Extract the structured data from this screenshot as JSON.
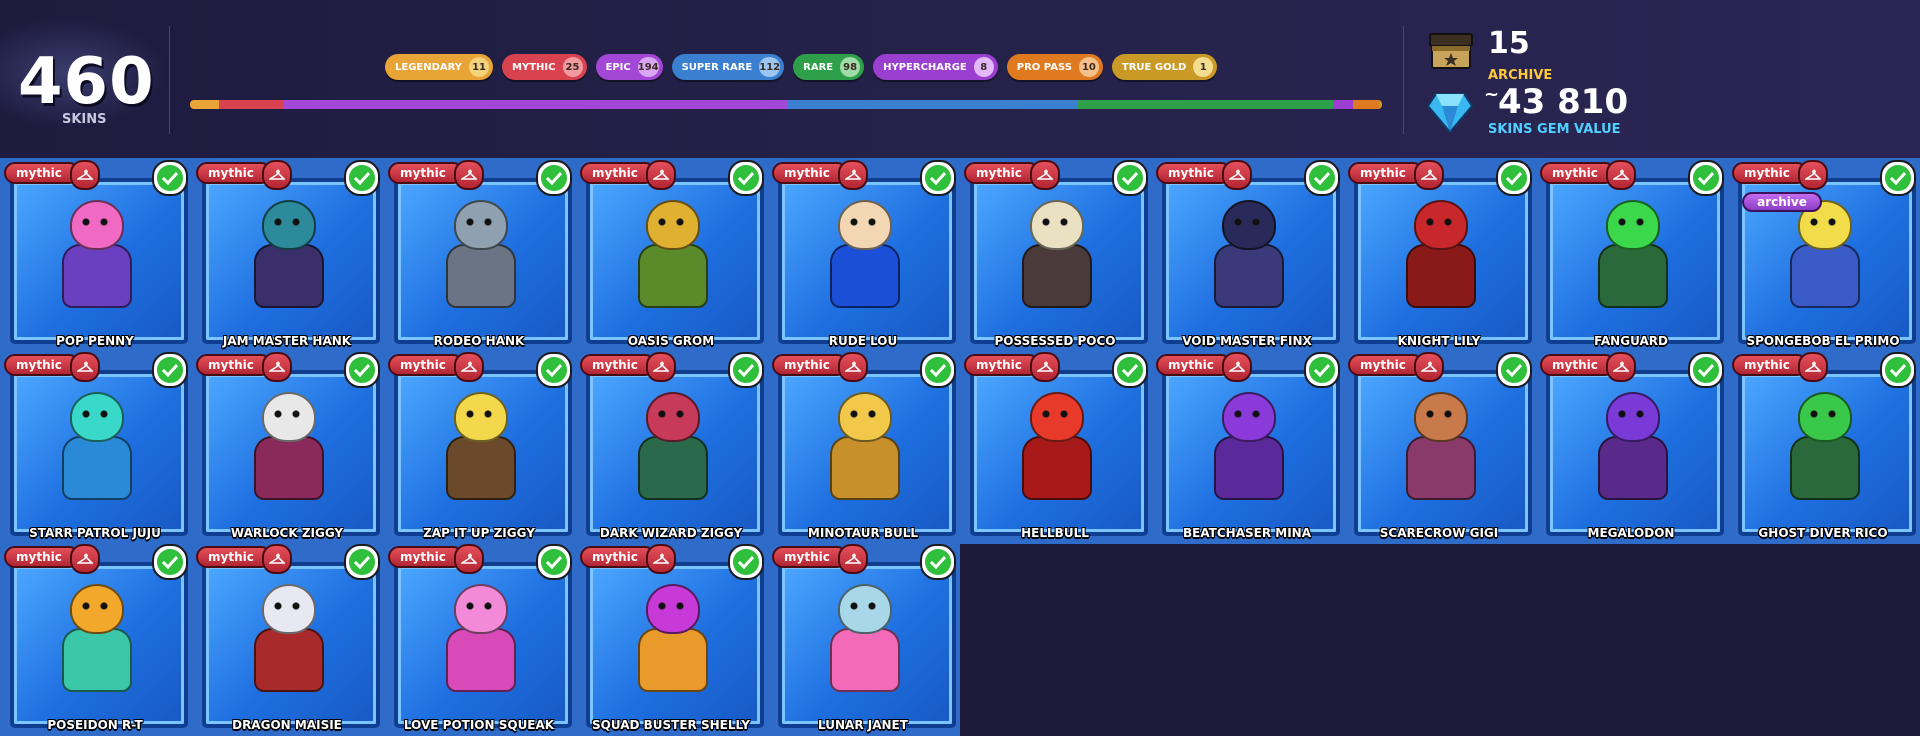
{
  "header": {
    "total_count": "460",
    "total_label": "SKINS",
    "rarities": [
      {
        "label": "LEGENDARY",
        "count": "11",
        "color": "#e8a436",
        "count_bg": "#f3d27a"
      },
      {
        "label": "MYTHIC",
        "count": "25",
        "color": "#d8434f",
        "count_bg": "#f29aa2"
      },
      {
        "label": "EPIC",
        "count": "194",
        "color": "#a347d6",
        "count_bg": "#d9a7f2"
      },
      {
        "label": "SUPER RARE",
        "count": "112",
        "color": "#3a7fd0",
        "count_bg": "#9cc6f2"
      },
      {
        "label": "RARE",
        "count": "98",
        "color": "#2fa04a",
        "count_bg": "#9fdca9"
      },
      {
        "label": "HYPERCHARGE",
        "count": "8",
        "color": "#9b3fd0",
        "count_bg": "#e2b8f7"
      },
      {
        "label": "PRO PASS",
        "count": "10",
        "color": "#e07a20",
        "count_bg": "#f6c08b"
      },
      {
        "label": "TRUE GOLD",
        "count": "1",
        "color": "#c99a26",
        "count_bg": "#f4dc91"
      }
    ],
    "archive_count": "15",
    "archive_label": "ARCHIVE",
    "gem_prefix": "~",
    "gem_value": "43 810",
    "gem_label": "SKINS GEM VALUE"
  },
  "badges": {
    "rarity": "mythic",
    "archive": "archive"
  },
  "colors": {
    "card_blue": "#2f6bc8",
    "badge_red": "#d8434f",
    "check_green": "#2fbf3a"
  },
  "skins": [
    {
      "name": "POP PENNY",
      "archive": false,
      "head": "#f06ac4",
      "body": "#6a3fc0"
    },
    {
      "name": "JAM MASTER HANK",
      "archive": false,
      "head": "#2c8a9a",
      "body": "#3a2f6a"
    },
    {
      "name": "RODEO HANK",
      "archive": false,
      "head": "#8fa0b0",
      "body": "#6a7484"
    },
    {
      "name": "OASIS GROM",
      "archive": false,
      "head": "#e0b030",
      "body": "#5a8a2a"
    },
    {
      "name": "RUDE LOU",
      "archive": false,
      "head": "#f3d7b5",
      "body": "#1c4fd8"
    },
    {
      "name": "POSSESSED POCO",
      "archive": false,
      "head": "#e9e1c2",
      "body": "#4a3a3a"
    },
    {
      "name": "VOID MASTER FINX",
      "archive": false,
      "head": "#2a2a5a",
      "body": "#3a3a7a"
    },
    {
      "name": "KNIGHT LILY",
      "archive": false,
      "head": "#c8282c",
      "body": "#8a1a1a"
    },
    {
      "name": "FANGUARD",
      "archive": false,
      "head": "#3ad84a",
      "body": "#2a6a3a"
    },
    {
      "name": "SPONGEBOB EL PRIMO",
      "archive": true,
      "head": "#f2dc4a",
      "body": "#3a5ac8"
    },
    {
      "name": "STARR PATROL JUJU",
      "archive": false,
      "head": "#3ad8c8",
      "body": "#2a8ad8"
    },
    {
      "name": "WARLOCK ZIGGY",
      "archive": false,
      "head": "#e8e8e8",
      "body": "#8a2a5a"
    },
    {
      "name": "ZAP IT UP ZIGGY",
      "archive": false,
      "head": "#f2d84a",
      "body": "#6a4a2a"
    },
    {
      "name": "DARK WIZARD ZIGGY",
      "archive": false,
      "head": "#c83a5a",
      "body": "#2a6a4a"
    },
    {
      "name": "MINOTAUR BULL",
      "archive": false,
      "head": "#f2c84a",
      "body": "#c8902a"
    },
    {
      "name": "HELLBULL",
      "archive": false,
      "head": "#e83a2a",
      "body": "#a81a1a"
    },
    {
      "name": "BEATCHASER MINA",
      "archive": false,
      "head": "#8a3ad8",
      "body": "#5a2a9a"
    },
    {
      "name": "SCARECROW GIGI",
      "archive": false,
      "head": "#c87a4a",
      "body": "#8a3a6a"
    },
    {
      "name": "MEGALODON",
      "archive": false,
      "head": "#7a3ad8",
      "body": "#5a2a8a"
    },
    {
      "name": "GHOST DIVER RICO",
      "archive": false,
      "head": "#3ac84a",
      "body": "#2a6a3a"
    },
    {
      "name": "POSEIDON R-T",
      "archive": false,
      "head": "#f2a82a",
      "body": "#3ac8a8"
    },
    {
      "name": "DRAGON MAISIE",
      "archive": false,
      "head": "#e8e8f2",
      "body": "#a82a2a"
    },
    {
      "name": "LOVE POTION SQUEAK",
      "archive": false,
      "head": "#f28ad8",
      "body": "#d84ab8"
    },
    {
      "name": "SQUAD BUSTER SHELLY",
      "archive": false,
      "head": "#c83ad8",
      "body": "#e89a2a"
    },
    {
      "name": "LUNAR JANET",
      "archive": false,
      "head": "#a8d8e8",
      "body": "#f26ab8"
    }
  ]
}
